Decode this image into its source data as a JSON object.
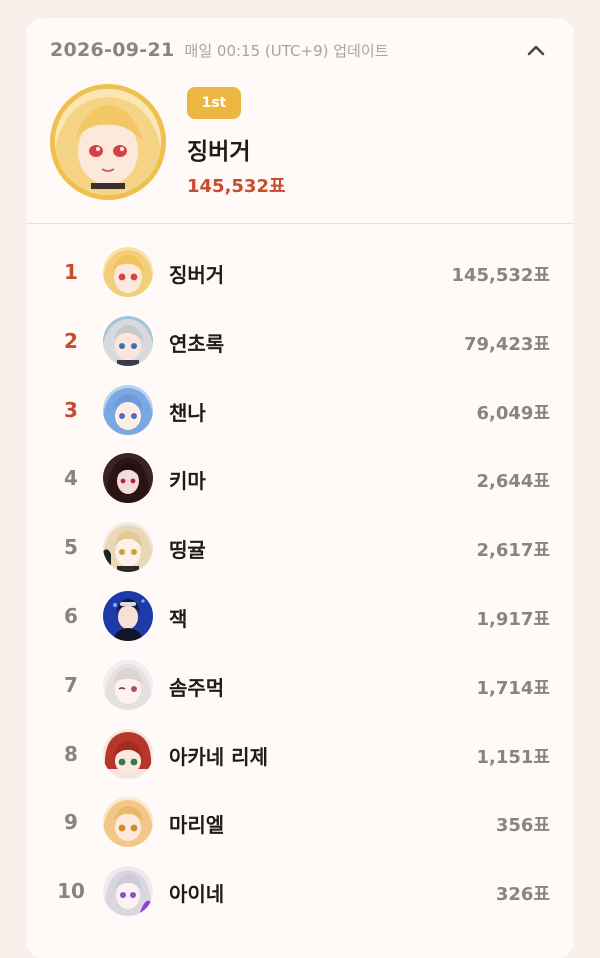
{
  "header": {
    "date": "2026-09-21",
    "update_text": "매일 00:15 (UTC+9) 업데이트",
    "collapse_icon": "chevron-up-icon"
  },
  "hero": {
    "badge": "1st",
    "name": "징버거",
    "votes": "145,532표"
  },
  "colors": {
    "accent_red": "#c94a2c",
    "gold": "#ecb640",
    "muted": "#8a8481",
    "background": "#f8efea",
    "card": "#fffaf7"
  },
  "ranking": [
    {
      "rank": "1",
      "name": "징버거",
      "votes": "145,532표"
    },
    {
      "rank": "2",
      "name": "연초록",
      "votes": "79,423표"
    },
    {
      "rank": "3",
      "name": "챈나",
      "votes": "6,049표"
    },
    {
      "rank": "4",
      "name": "키마",
      "votes": "2,644표"
    },
    {
      "rank": "5",
      "name": "띵귤",
      "votes": "2,617표"
    },
    {
      "rank": "6",
      "name": "잭",
      "votes": "1,917표"
    },
    {
      "rank": "7",
      "name": "솜주먹",
      "votes": "1,714표"
    },
    {
      "rank": "8",
      "name": "아카네 리제",
      "votes": "1,151표"
    },
    {
      "rank": "9",
      "name": "마리엘",
      "votes": "356표"
    },
    {
      "rank": "10",
      "name": "아이네",
      "votes": "326표"
    }
  ]
}
